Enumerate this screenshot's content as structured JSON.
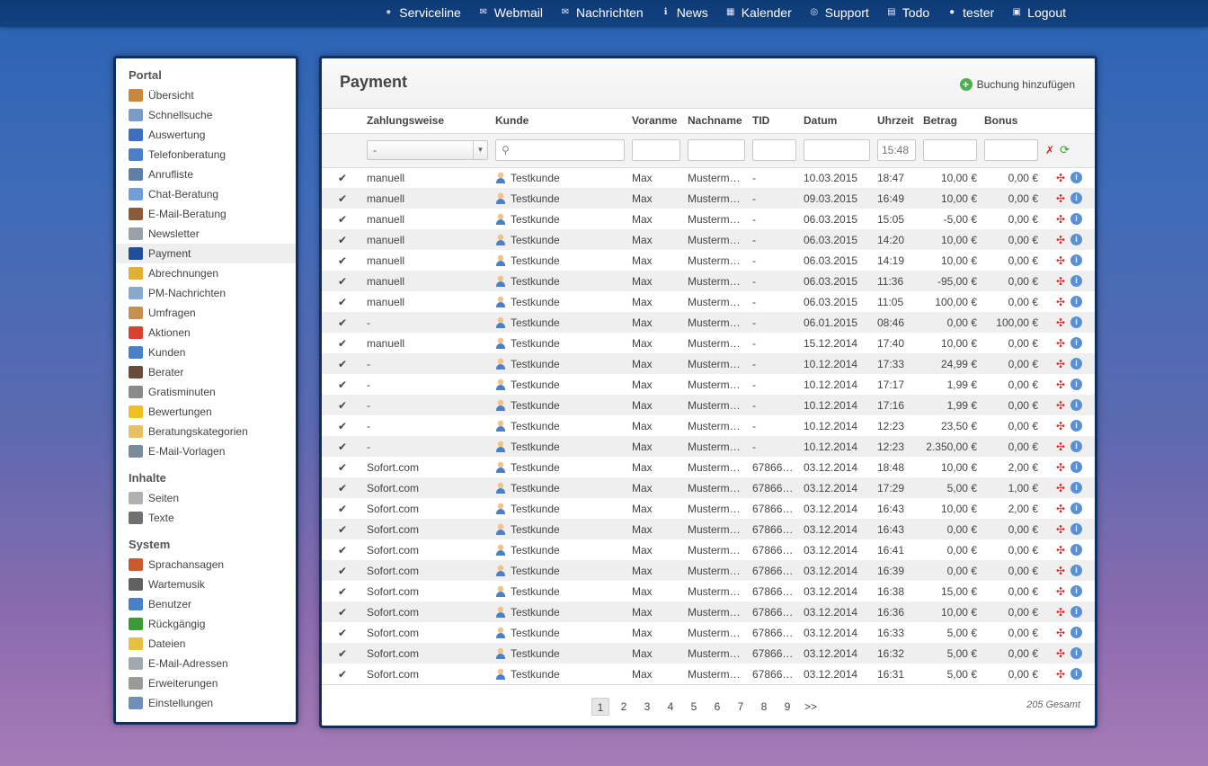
{
  "topnav": [
    {
      "label": "Serviceline",
      "icon": "dot-icon"
    },
    {
      "label": "Webmail",
      "icon": "webmail-icon"
    },
    {
      "label": "Nachrichten",
      "icon": "envelope-icon"
    },
    {
      "label": "News",
      "icon": "info-icon"
    },
    {
      "label": "Kalender",
      "icon": "calendar-icon"
    },
    {
      "label": "Support",
      "icon": "lifebuoy-icon"
    },
    {
      "label": "Todo",
      "icon": "note-icon"
    },
    {
      "label": "tester",
      "icon": "user-icon"
    },
    {
      "label": "Logout",
      "icon": "lock-icon"
    }
  ],
  "sidebar": {
    "portal_title": "Portal",
    "portal_items": [
      {
        "label": "Übersicht",
        "color": "#c9873c"
      },
      {
        "label": "Schnellsuche",
        "color": "#7a9cc8"
      },
      {
        "label": "Auswertung",
        "color": "#3c6fc0"
      },
      {
        "label": "Telefonberatung",
        "color": "#4a7fc9"
      },
      {
        "label": "Anrufliste",
        "color": "#5f7fa8"
      },
      {
        "label": "Chat-Beratung",
        "color": "#6f9ed8"
      },
      {
        "label": "E-Mail-Beratung",
        "color": "#8a5a3a"
      },
      {
        "label": "Newsletter",
        "color": "#9aa0a8"
      },
      {
        "label": "Payment",
        "color": "#1f4f9a"
      },
      {
        "label": "Abrechnungen",
        "color": "#e0b030"
      },
      {
        "label": "PM-Nachrichten",
        "color": "#88a8cc"
      },
      {
        "label": "Umfragen",
        "color": "#c89050"
      },
      {
        "label": "Aktionen",
        "color": "#d84030"
      },
      {
        "label": "Kunden",
        "color": "#4a7fc9"
      },
      {
        "label": "Berater",
        "color": "#6a4a3a"
      },
      {
        "label": "Gratisminuten",
        "color": "#8a8a8a"
      },
      {
        "label": "Bewertungen",
        "color": "#f0c020"
      },
      {
        "label": "Beratungskategorien",
        "color": "#e8c060"
      },
      {
        "label": "E-Mail-Vorlagen",
        "color": "#7a8a9a"
      }
    ],
    "inhalte_title": "Inhalte",
    "inhalte_items": [
      {
        "label": "Seiten",
        "color": "#b0b0b0"
      },
      {
        "label": "Texte",
        "color": "#707070"
      }
    ],
    "system_title": "System",
    "system_items": [
      {
        "label": "Sprachansagen",
        "color": "#c85a30"
      },
      {
        "label": "Wartemusik",
        "color": "#606060"
      },
      {
        "label": "Benutzer",
        "color": "#4a7fc9"
      },
      {
        "label": "Rückgängig",
        "color": "#3a9a35"
      },
      {
        "label": "Dateien",
        "color": "#e8c040"
      },
      {
        "label": "E-Mail-Adressen",
        "color": "#a0a8b0"
      },
      {
        "label": "Erweiterungen",
        "color": "#9a9a9a"
      },
      {
        "label": "Einstellungen",
        "color": "#6f8fb8"
      }
    ]
  },
  "main": {
    "title": "Payment",
    "add_label": "Buchung hinzufügen",
    "columns": [
      "Zahlungsweise",
      "Kunde",
      "Voranme",
      "Nachname",
      "TID",
      "Datum",
      "Uhrzeit",
      "Betrag",
      "Bonus"
    ],
    "filters": {
      "zahlungsweise_selected": "-",
      "kunde_value": "",
      "vorname_value": "",
      "nachname_value": "",
      "tid_value": "",
      "datum_value": "",
      "uhrzeit_placeholder": "15:48",
      "betrag_value": "",
      "bonus_value": ""
    },
    "rows": [
      {
        "method": "manuell",
        "customer": "Testkunde",
        "first": "Max",
        "last": "Musterm…",
        "tid": "-",
        "date": "10.03.2015",
        "time": "18:47",
        "amount": "10,00 €",
        "amount_sign": "pos",
        "bonus": "0,00 €"
      },
      {
        "method": "manuell",
        "customer": "Testkunde",
        "first": "Max",
        "last": "Musterm…",
        "tid": "-",
        "date": "09.03.2015",
        "time": "16:49",
        "amount": "10,00 €",
        "amount_sign": "pos",
        "bonus": "0,00 €"
      },
      {
        "method": "manuell",
        "customer": "Testkunde",
        "first": "Max",
        "last": "Musterm…",
        "tid": "-",
        "date": "06.03.2015",
        "time": "15:05",
        "amount": "-5,00 €",
        "amount_sign": "neg",
        "bonus": "0,00 €"
      },
      {
        "method": "manuell",
        "customer": "Testkunde",
        "first": "Max",
        "last": "Musterm…",
        "tid": "-",
        "date": "06.03.2015",
        "time": "14:20",
        "amount": "10,00 €",
        "amount_sign": "pos",
        "bonus": "0,00 €"
      },
      {
        "method": "manuell",
        "customer": "Testkunde",
        "first": "Max",
        "last": "Musterm…",
        "tid": "-",
        "date": "06.03.2015",
        "time": "14:19",
        "amount": "10,00 €",
        "amount_sign": "pos",
        "bonus": "0,00 €"
      },
      {
        "method": "manuell",
        "customer": "Testkunde",
        "first": "Max",
        "last": "Musterm…",
        "tid": "-",
        "date": "06.03.2015",
        "time": "11:36",
        "amount": "-95,00 €",
        "amount_sign": "neg",
        "bonus": "0,00 €"
      },
      {
        "method": "manuell",
        "customer": "Testkunde",
        "first": "Max",
        "last": "Musterm…",
        "tid": "-",
        "date": "06.03.2015",
        "time": "11:05",
        "amount": "100,00 €",
        "amount_sign": "pos",
        "bonus": "0,00 €"
      },
      {
        "method": "-",
        "customer": "Testkunde",
        "first": "Max",
        "last": "Musterm…",
        "tid": "-",
        "date": "06.01.2015",
        "time": "08:46",
        "amount": "0,00 €",
        "amount_sign": "neg",
        "bonus": "100,00 €"
      },
      {
        "method": "manuell",
        "customer": "Testkunde",
        "first": "Max",
        "last": "Musterm…",
        "tid": "-",
        "date": "15.12.2014",
        "time": "17:40",
        "amount": "10,00 €",
        "amount_sign": "pos",
        "bonus": "0,00 €"
      },
      {
        "method": "-",
        "customer": "Testkunde",
        "first": "Max",
        "last": "Musterm…",
        "tid": "-",
        "date": "10.12.2014",
        "time": "17:33",
        "amount": "24,99 €",
        "amount_sign": "pos",
        "bonus": "0,00 €"
      },
      {
        "method": "-",
        "customer": "Testkunde",
        "first": "Max",
        "last": "Musterm…",
        "tid": "-",
        "date": "10.12.2014",
        "time": "17:17",
        "amount": "1,99 €",
        "amount_sign": "pos",
        "bonus": "0,00 €"
      },
      {
        "method": "-",
        "customer": "Testkunde",
        "first": "Max",
        "last": "Musterm…",
        "tid": "-",
        "date": "10.12.2014",
        "time": "17:16",
        "amount": "1,99 €",
        "amount_sign": "pos",
        "bonus": "0,00 €"
      },
      {
        "method": "-",
        "customer": "Testkunde",
        "first": "Max",
        "last": "Musterm…",
        "tid": "-",
        "date": "10.12.2014",
        "time": "12:23",
        "amount": "23,50 €",
        "amount_sign": "pos",
        "bonus": "0,00 €"
      },
      {
        "method": "-",
        "customer": "Testkunde",
        "first": "Max",
        "last": "Musterm…",
        "tid": "-",
        "date": "10.12.2014",
        "time": "12:23",
        "amount": "2.350,00 €",
        "amount_sign": "pos",
        "bonus": "0,00 €"
      },
      {
        "method": "Sofort.com",
        "customer": "Testkunde",
        "first": "Max",
        "last": "Musterm…",
        "tid": "67866…",
        "date": "03.12.2014",
        "time": "18:48",
        "amount": "10,00 €",
        "amount_sign": "pos",
        "bonus": "2,00 €"
      },
      {
        "method": "Sofort.com",
        "customer": "Testkunde",
        "first": "Max",
        "last": "Musterm…",
        "tid": "67866…",
        "date": "03.12.2014",
        "time": "17:29",
        "amount": "5,00 €",
        "amount_sign": "pos",
        "bonus": "1,00 €"
      },
      {
        "method": "Sofort.com",
        "customer": "Testkunde",
        "first": "Max",
        "last": "Musterm…",
        "tid": "67866…",
        "date": "03.12.2014",
        "time": "16:43",
        "amount": "10,00 €",
        "amount_sign": "pos",
        "bonus": "2,00 €"
      },
      {
        "method": "Sofort.com",
        "customer": "Testkunde",
        "first": "Max",
        "last": "Musterm…",
        "tid": "67866…",
        "date": "03.12.2014",
        "time": "16:43",
        "amount": "0,00 €",
        "amount_sign": "neg",
        "bonus": "0,00 €"
      },
      {
        "method": "Sofort.com",
        "customer": "Testkunde",
        "first": "Max",
        "last": "Musterm…",
        "tid": "67866…",
        "date": "03.12.2014",
        "time": "16:41",
        "amount": "0,00 €",
        "amount_sign": "neg",
        "bonus": "0,00 €"
      },
      {
        "method": "Sofort.com",
        "customer": "Testkunde",
        "first": "Max",
        "last": "Musterm…",
        "tid": "67866…",
        "date": "03.12.2014",
        "time": "16:39",
        "amount": "0,00 €",
        "amount_sign": "neg",
        "bonus": "0,00 €"
      },
      {
        "method": "Sofort.com",
        "customer": "Testkunde",
        "first": "Max",
        "last": "Musterm…",
        "tid": "67866…",
        "date": "03.12.2014",
        "time": "16:38",
        "amount": "15,00 €",
        "amount_sign": "pos",
        "bonus": "0,00 €"
      },
      {
        "method": "Sofort.com",
        "customer": "Testkunde",
        "first": "Max",
        "last": "Musterm…",
        "tid": "67866…",
        "date": "03.12.2014",
        "time": "16:36",
        "amount": "10,00 €",
        "amount_sign": "pos",
        "bonus": "0,00 €"
      },
      {
        "method": "Sofort.com",
        "customer": "Testkunde",
        "first": "Max",
        "last": "Musterm…",
        "tid": "67866…",
        "date": "03.12.2014",
        "time": "16:33",
        "amount": "5,00 €",
        "amount_sign": "pos",
        "bonus": "0,00 €"
      },
      {
        "method": "Sofort.com",
        "customer": "Testkunde",
        "first": "Max",
        "last": "Musterm…",
        "tid": "67866…",
        "date": "03.12.2014",
        "time": "16:32",
        "amount": "5,00 €",
        "amount_sign": "pos",
        "bonus": "0,00 €"
      },
      {
        "method": "Sofort.com",
        "customer": "Testkunde",
        "first": "Max",
        "last": "Musterm…",
        "tid": "67866…",
        "date": "03.12.2014",
        "time": "16:31",
        "amount": "5,00 €",
        "amount_sign": "pos",
        "bonus": "0,00 €"
      }
    ],
    "pagination": {
      "pages": [
        "1",
        "2",
        "3",
        "4",
        "5",
        "6",
        "7",
        "8",
        "9",
        ">>"
      ],
      "current": "1",
      "total_label": "205 Gesamt"
    }
  },
  "colors": {
    "topbar": "#0f3a78",
    "panel_border": "#0d2f63",
    "positive": "#2f8b2f",
    "negative": "#e02020",
    "check": "#3a9a35"
  }
}
